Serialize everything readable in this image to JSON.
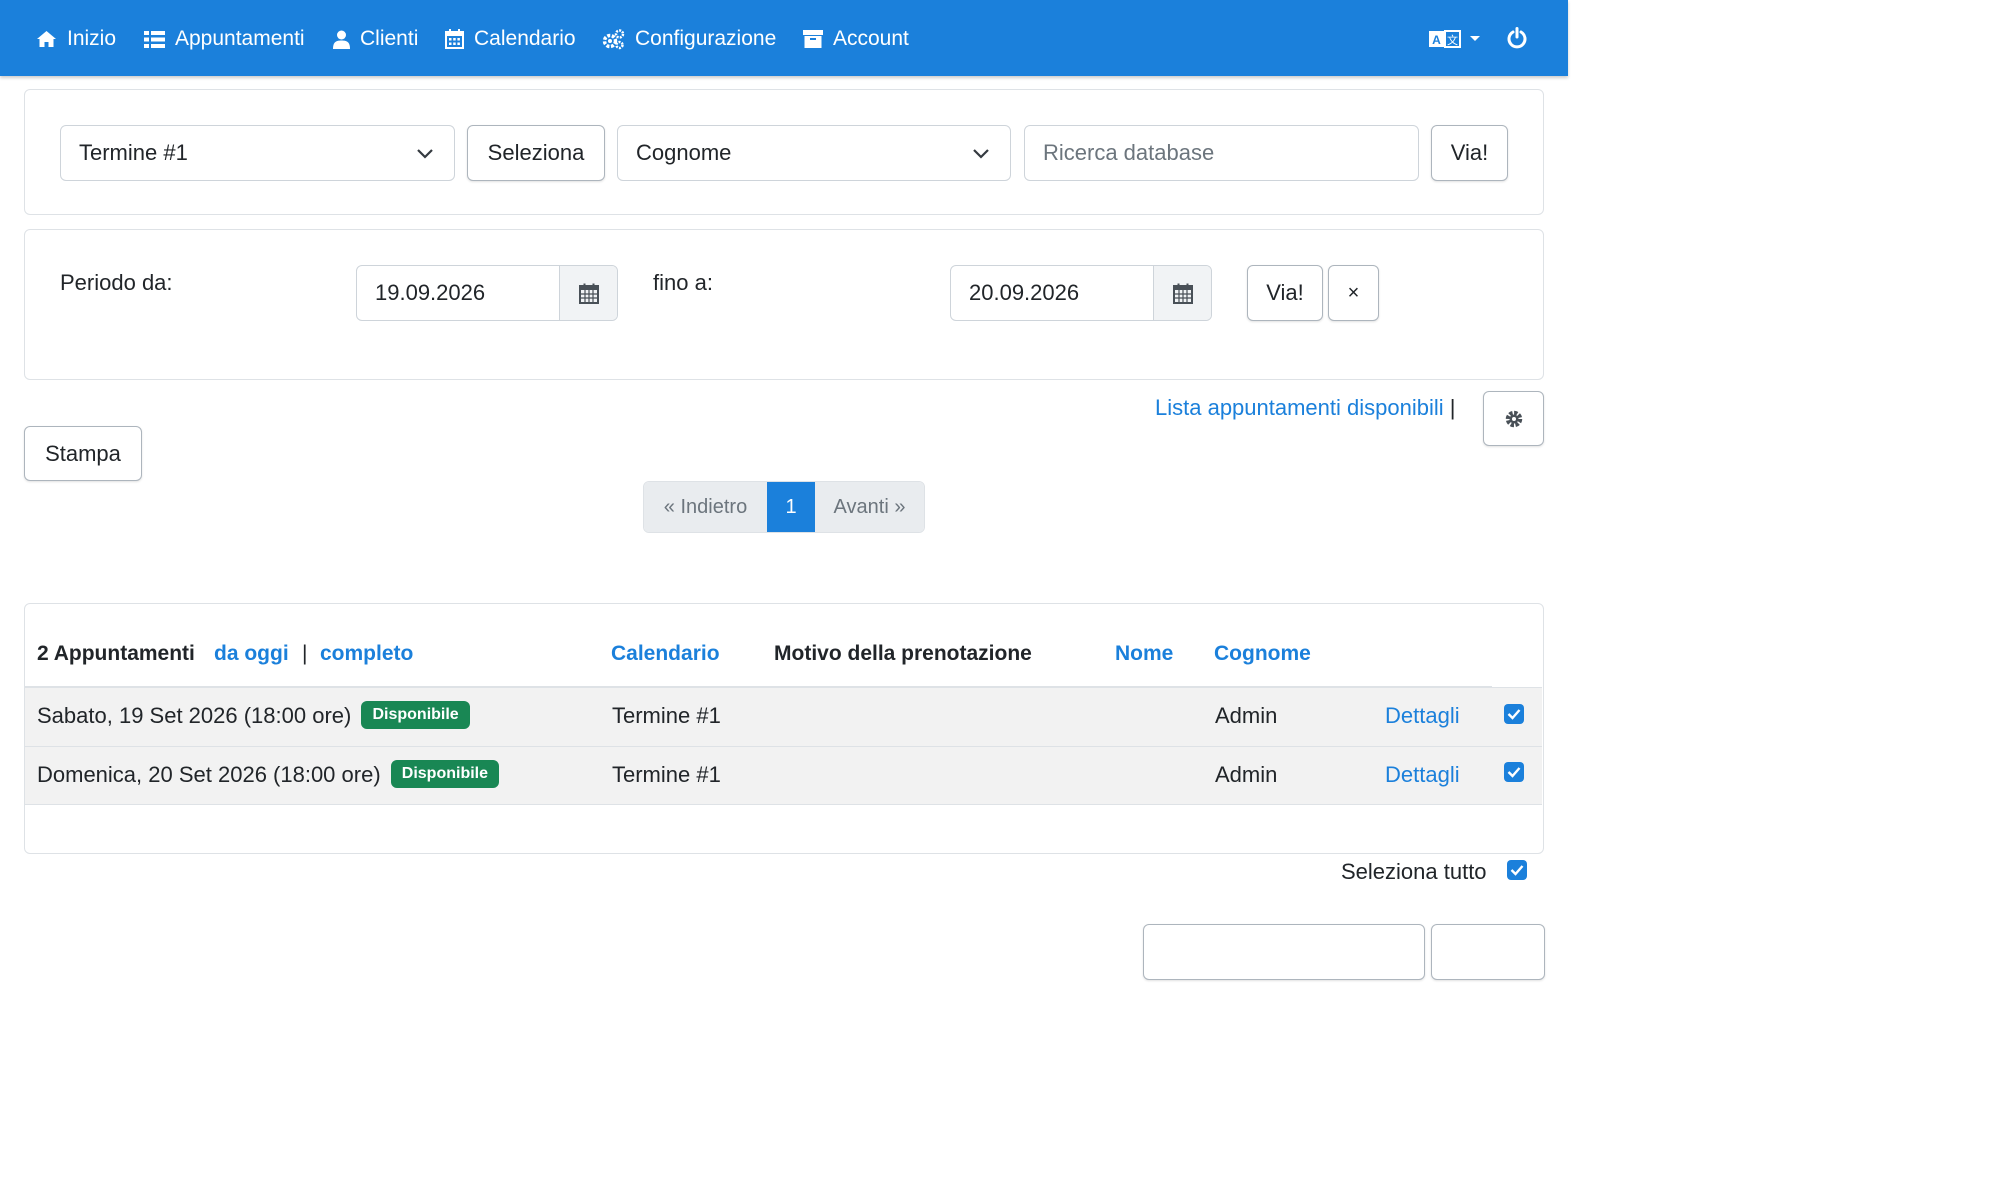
{
  "nav": {
    "items": [
      {
        "label": "Inizio",
        "icon": "home-icon"
      },
      {
        "label": "Appuntamenti",
        "icon": "list-icon"
      },
      {
        "label": "Clienti",
        "icon": "user-icon"
      },
      {
        "label": "Calendario",
        "icon": "calendar-icon"
      },
      {
        "label": "Configurazione",
        "icon": "cogs-icon"
      },
      {
        "label": "Account",
        "icon": "archive-icon"
      }
    ],
    "language_icon": "language-icon",
    "power_icon": "power-icon"
  },
  "search": {
    "term_select": "Termine #1",
    "select_button": "Seleziona",
    "field_select": "Cognome",
    "search_placeholder": "Ricerca database",
    "go_button": "Via!"
  },
  "period": {
    "from_label": "Periodo da:",
    "from_value": "19.09.2026",
    "to_label": "fino a:",
    "to_value": "20.09.2026",
    "go_button": "Via!",
    "clear_button": "×"
  },
  "actions": {
    "available_list_link": "Lista appuntamenti disponibili",
    "separator": "|",
    "print_button": "Stampa"
  },
  "pager": {
    "prev": "« Indietro",
    "current": "1",
    "next": "Avanti »"
  },
  "table": {
    "count_label": "2 Appuntamenti",
    "from_today_link": "da oggi",
    "separator": "|",
    "complete_link": "completo",
    "headers": {
      "calendar": "Calendario",
      "reason": "Motivo della prenotazione",
      "name": "Nome",
      "surname": "Cognome"
    },
    "rows": [
      {
        "date": "Sabato, 19 Set 2026 (18:00 ore)",
        "status": "Disponibile",
        "calendar": "Termine #1",
        "reason": "",
        "name": "",
        "surname": "Admin",
        "details": "Dettagli",
        "checked": true
      },
      {
        "date": "Domenica, 20 Set 2026 (18:00 ore)",
        "status": "Disponibile",
        "calendar": "Termine #1",
        "reason": "",
        "name": "",
        "surname": "Admin",
        "details": "Dettagli",
        "checked": true
      }
    ]
  },
  "footer": {
    "select_all": "Seleziona tutto"
  },
  "colors": {
    "primary": "#1b80db",
    "success": "#198754"
  }
}
